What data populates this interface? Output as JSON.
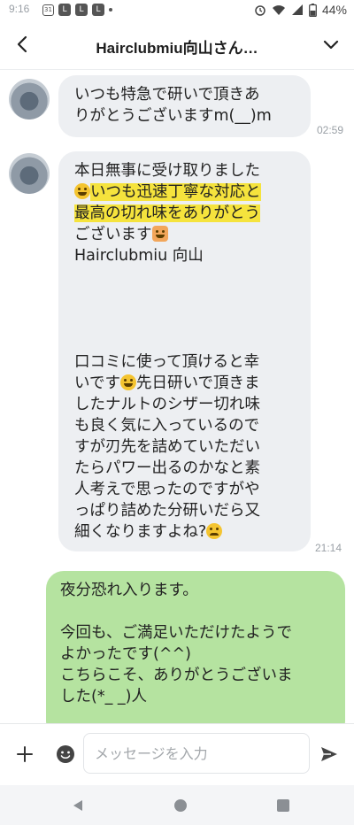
{
  "status_bar": {
    "time": "9:16",
    "calendar_day": "31",
    "notification_icons": [
      "L",
      "L",
      "L"
    ],
    "battery": "44%"
  },
  "header": {
    "title": "Hairclubmiu向山さん…"
  },
  "messages": [
    {
      "sender": "other",
      "lines": [
        "いつも特急で研いで頂きあ",
        "りがとうございますm(__)m"
      ],
      "time": "02:59"
    },
    {
      "sender": "other",
      "segments": {
        "l1": "本日無事に受け取りました",
        "l2_hl": "いつも迅速丁寧な対応と",
        "l3_hl": "最高の切れ味をありがとう",
        "l4": "ございます",
        "l5": "Hairclubmiu  向山",
        "l6": "口コミに使って頂けると幸",
        "l7": "いです",
        "l7b": "先日研いで頂きま",
        "l8": "したナルトのシザー切れ味",
        "l9": "も良く気に入っているので",
        "l10": "すが刃先を詰めていただい",
        "l11": "たらパワー出るのかなと素",
        "l12": "人考えで思ったのですがや",
        "l13": "っぱり詰めた分研いだら又",
        "l14": "細くなりますよね?"
      },
      "time": "21:14"
    },
    {
      "sender": "me",
      "lines": [
        "夜分恐れ入ります。",
        "",
        "今回も、ご満足いただけたようで",
        "よかったです(^^)",
        "こちらこそ、ありがとうございま",
        "した(*_ _)人"
      ]
    }
  ],
  "input": {
    "placeholder": "メッセージを入力"
  },
  "colors": {
    "incoming_bubble": "#edeff2",
    "outgoing_bubble": "#b5e3a0",
    "highlight": "#f5e33d"
  },
  "icons": [
    "back-arrow-icon",
    "chevron-down-icon",
    "plus-icon",
    "emoji-icon",
    "send-icon",
    "nav-back-icon",
    "nav-home-icon",
    "nav-recents-icon"
  ]
}
